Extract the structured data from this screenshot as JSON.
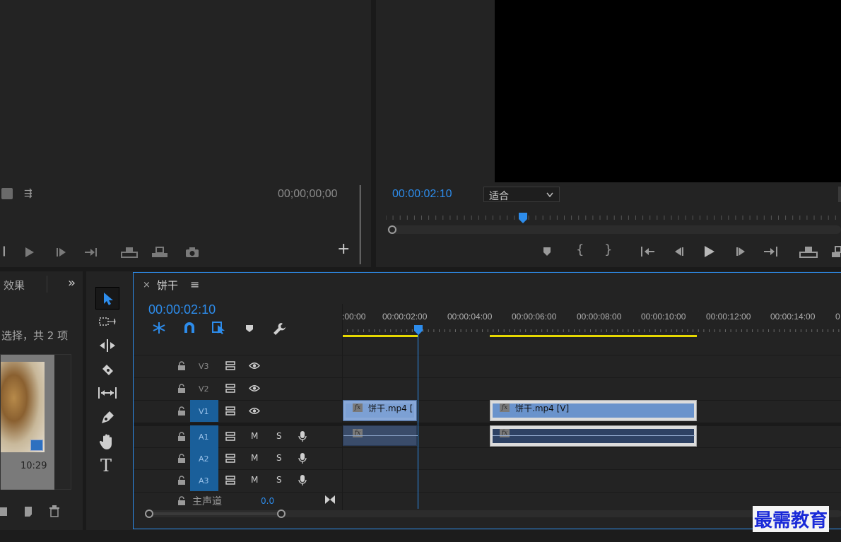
{
  "source_monitor": {
    "timecode": "00;00;00;00"
  },
  "program_monitor": {
    "timecode": "00:00:02:10",
    "zoom_select": "适合"
  },
  "project_panel": {
    "tab_label": "效果",
    "status_text": "选择，共 2 项",
    "thumb_duration": "10:29"
  },
  "timeline": {
    "close_label": "×",
    "sequence_name": "饼干",
    "menu_label": "≡",
    "timecode": "00:00:02:10",
    "ruler_labels": [
      ":00:00",
      "00:00:02:00",
      "00:00:04:00",
      "00:00:06:00",
      "00:00:08:00",
      "00:00:10:00",
      "00:00:12:00",
      "00:00:14:00",
      "0"
    ],
    "tracks": {
      "v3": "V3",
      "v2": "V2",
      "v1": "V1",
      "a1": "A1",
      "a2": "A2",
      "a3": "A3",
      "mute": "M",
      "solo": "S"
    },
    "master": {
      "label": "主声道",
      "value": "0.0"
    },
    "clips": {
      "v1_clip1": "饼干.mp4 [",
      "v1_clip2": "饼干.mp4 [V]",
      "fx": "fx"
    }
  },
  "tools": {
    "type_tool": "T"
  },
  "watermark": "最需教育",
  "colors": {
    "accent": "#2d8ceb",
    "track_target": "#1a5f9a",
    "inout_bar": "#e6d800"
  }
}
